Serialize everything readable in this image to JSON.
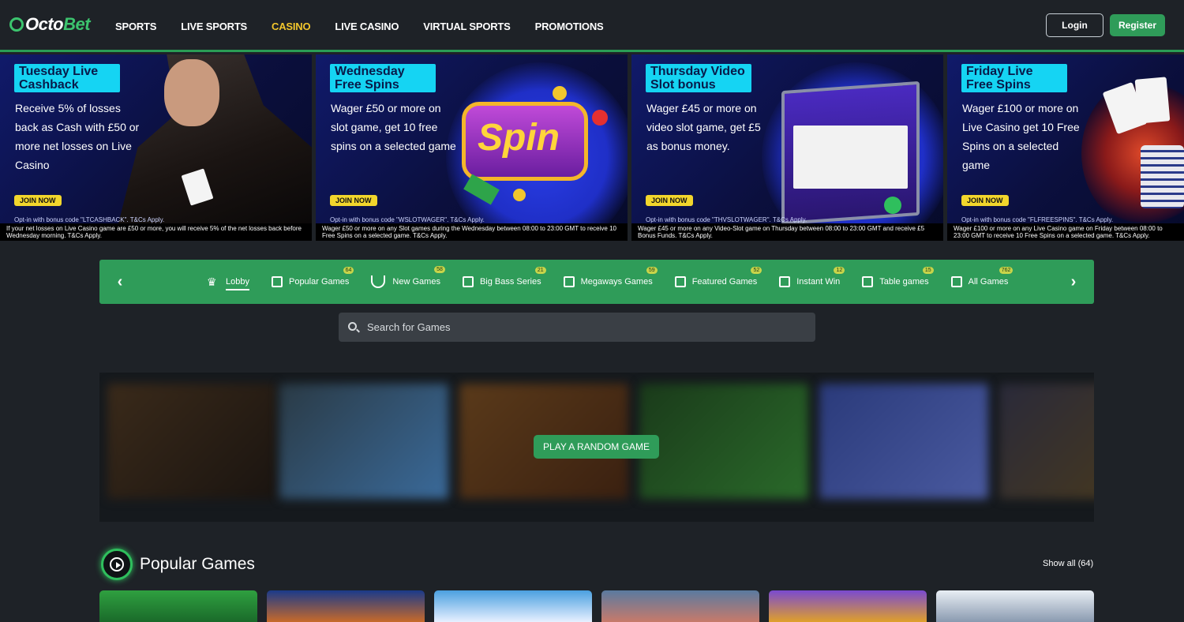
{
  "brand": {
    "logo_prefix": "Octo",
    "logo_suffix": "Bet"
  },
  "nav": [
    "SPORTS",
    "LIVE SPORTS",
    "CASINO",
    "LIVE CASINO",
    "VIRTUAL SPORTS",
    "PROMOTIONS"
  ],
  "nav_active": "CASINO",
  "auth": {
    "login": "Login",
    "register": "Register"
  },
  "banners": [
    {
      "title": "Tuesday Live Cashback",
      "desc": "Receive 5% of losses back as Cash with £50 or more net losses on Live Casino",
      "cta": "JOIN NOW",
      "optin": "Opt-in with bonus code \"LTCASHBACK\". T&Cs Apply.",
      "terms": "If your net losses on Live Casino game are £50 or more, you will receive 5% of the net losses back before Wednesday morning. T&Cs Apply."
    },
    {
      "title": "Wednesday Free Spins",
      "desc": "Wager £50 or more on slot game, get 10 free spins on a selected game",
      "cta": "JOIN NOW",
      "optin": "Opt-in with bonus code \"WSLOTWAGER\". T&Cs Apply.",
      "terms": "Wager £50 or more on any Slot games during the Wednesday between 08:00 to 23:00 GMT to receive 10 Free Spins on a selected game. T&Cs Apply."
    },
    {
      "title": "Thursday Video Slot bonus",
      "desc": "Wager £45 or more on video slot game, get £5 as bonus money.",
      "cta": "JOIN NOW",
      "optin": "Opt-in with bonus code \"THVSLOTWAGER\". T&Cs Apply.",
      "terms": "Wager £45 or more on any Video-Slot game on Thursday between 08:00 to 23:00 GMT and receive £5 Bonus Funds. T&Cs Apply."
    },
    {
      "title": "Friday Live Free Spins",
      "desc": "Wager £100 or more on Live Casino get 10 Free Spins on a selected game",
      "cta": "JOIN NOW",
      "optin": "Opt-in with bonus code \"FLFREESPINS\". T&Cs Apply.",
      "terms": "Wager £100 or more on any Live Casino game on Friday between 08:00 to 23:00 GMT to receive 10 Free Spins on a selected game. T&Cs Apply."
    }
  ],
  "categories": [
    {
      "label": "Lobby",
      "badge": "",
      "icon": "crown-icon",
      "active": true
    },
    {
      "label": "Popular Games",
      "badge": "64",
      "icon": "grid-icon"
    },
    {
      "label": "New Games",
      "badge": "58",
      "icon": "horseshoe-icon"
    },
    {
      "label": "Big Bass Series",
      "badge": "21",
      "icon": "grid-icon"
    },
    {
      "label": "Megaways Games",
      "badge": "59",
      "icon": "grid-icon"
    },
    {
      "label": "Featured Games",
      "badge": "52",
      "icon": "grid-icon"
    },
    {
      "label": "Instant Win",
      "badge": "12",
      "icon": "grid-icon"
    },
    {
      "label": "Table games",
      "badge": "15",
      "icon": "grid-icon"
    },
    {
      "label": "All Games",
      "badge": "762",
      "icon": "grid-icon"
    }
  ],
  "search": {
    "placeholder": "Search for Games"
  },
  "random_game": {
    "label": "PLAY A RANDOM GAME"
  },
  "popular": {
    "title": "Popular Games",
    "show_all": "Show all (64)"
  },
  "colors": {
    "brand_green": "#2f9c59",
    "accent_yellow": "#f2c62c",
    "banner_title_bg": "#15d4f3"
  }
}
